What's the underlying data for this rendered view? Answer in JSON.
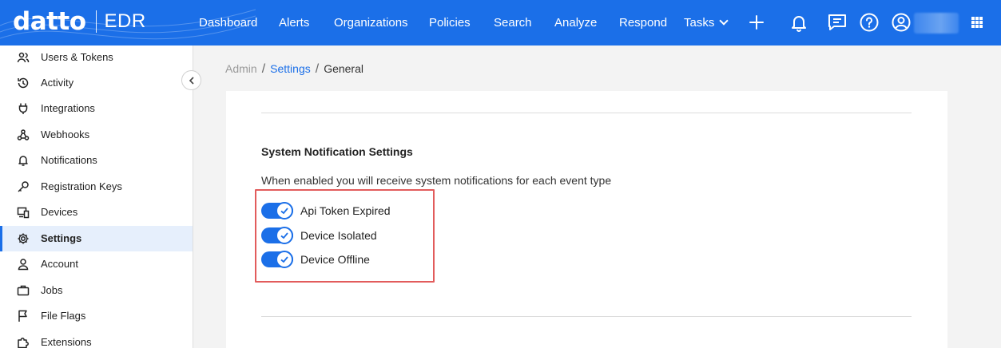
{
  "header": {
    "logo_word": "datto",
    "product": "EDR",
    "nav": [
      {
        "label": "Dashboard"
      },
      {
        "label": "Alerts"
      },
      {
        "label": "Organizations"
      },
      {
        "label": "Policies"
      },
      {
        "label": "Search"
      },
      {
        "label": "Analyze"
      },
      {
        "label": "Respond"
      },
      {
        "label": "Tasks"
      }
    ],
    "icons": [
      "plus-icon",
      "bell-icon",
      "chat-icon",
      "help-icon",
      "user-avatar-icon",
      "apps-grid-icon"
    ],
    "accent_color": "#1b6fe8"
  },
  "sidebar": {
    "items": [
      {
        "label": "Users & Tokens",
        "icon": "users-icon"
      },
      {
        "label": "Activity",
        "icon": "history-icon"
      },
      {
        "label": "Integrations",
        "icon": "plug-icon"
      },
      {
        "label": "Webhooks",
        "icon": "webhook-icon"
      },
      {
        "label": "Notifications",
        "icon": "bell-icon"
      },
      {
        "label": "Registration Keys",
        "icon": "key-icon"
      },
      {
        "label": "Devices",
        "icon": "devices-icon"
      },
      {
        "label": "Settings",
        "icon": "gear-icon",
        "active": true
      },
      {
        "label": "Account",
        "icon": "person-icon"
      },
      {
        "label": "Jobs",
        "icon": "briefcase-icon"
      },
      {
        "label": "File Flags",
        "icon": "flag-icon"
      },
      {
        "label": "Extensions",
        "icon": "puzzle-icon"
      }
    ]
  },
  "breadcrumb": {
    "items": [
      "Admin",
      "Settings",
      "General"
    ]
  },
  "notifications": {
    "title": "System Notification Settings",
    "description": "When enabled you will receive system notifications for each event type",
    "toggles": [
      {
        "label": "Api Token Expired",
        "enabled": true
      },
      {
        "label": "Device Isolated",
        "enabled": true
      },
      {
        "label": "Device Offline",
        "enabled": true
      }
    ],
    "highlight_color": "#e25c5c"
  }
}
